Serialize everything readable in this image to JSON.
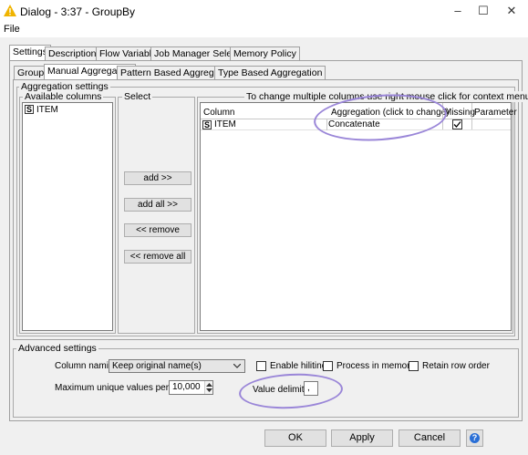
{
  "window": {
    "title": "Dialog - 3:37 - GroupBy"
  },
  "menu": {
    "file": "File"
  },
  "tabs": [
    "Settings",
    "Description",
    "Flow Variables",
    "Job Manager Selection",
    "Memory Policy"
  ],
  "subtabs": [
    "Groups",
    "Manual Aggregation",
    "Pattern Based Aggregation",
    "Type Based Aggregation"
  ],
  "aggregation_settings": {
    "title": "Aggregation settings",
    "available_columns": {
      "title": "Available columns",
      "items": [
        {
          "type": "S",
          "name": "ITEM"
        }
      ]
    },
    "select": {
      "title": "Select",
      "add": "add >>",
      "add_all": "add all >>",
      "remove": "<< remove",
      "remove_all": "<< remove all"
    },
    "hint": "To change multiple columns use right mouse click for context menu.",
    "table": {
      "headers": {
        "column": "Column",
        "aggregation": "Aggregation (click to change)",
        "missing": "Missing",
        "parameter": "Parameter"
      },
      "rows": [
        {
          "type": "S",
          "column": "ITEM",
          "aggregation": "Concatenate",
          "missing": true,
          "parameter": ""
        }
      ]
    }
  },
  "advanced": {
    "title": "Advanced settings",
    "column_naming_label": "Column naming:",
    "column_naming_value": "Keep original name(s)",
    "enable_hiliting": "Enable hiliting",
    "process_in_memory": "Process in memory",
    "retain_row_order": "Retain row order",
    "max_unique_label": "Maximum unique values per group",
    "max_unique_value": "10,000",
    "value_delimiter_label": "Value delimiter",
    "value_delimiter_value": ","
  },
  "buttons": {
    "ok": "OK",
    "apply": "Apply",
    "cancel": "Cancel",
    "help": "?"
  },
  "colors": {
    "annotation": "#9a86d8",
    "warning": "#f0b400",
    "help_blue": "#2a6fd6"
  },
  "icons": [
    "warning-icon",
    "minimize-icon",
    "maximize-icon",
    "close-icon",
    "checkmark-icon",
    "chevron-down-icon",
    "spinner-up-icon",
    "spinner-down-icon",
    "help-icon"
  ]
}
